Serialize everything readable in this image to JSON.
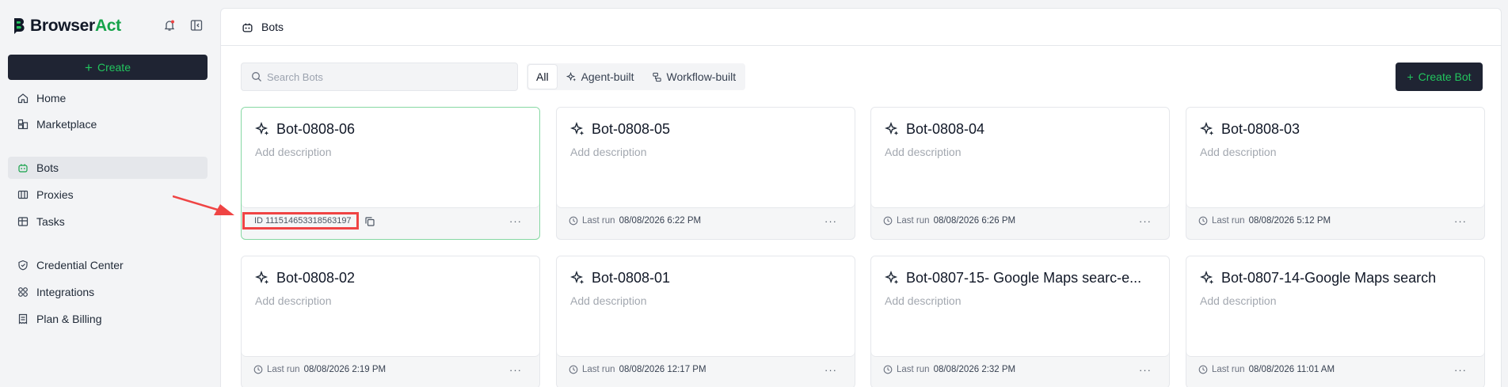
{
  "brand": {
    "name_part1": "Browser",
    "name_part2": "Act",
    "accent_color": "#16a34a"
  },
  "sidebar": {
    "create_label": "Create",
    "items": [
      {
        "label": "Home",
        "icon": "home-icon"
      },
      {
        "label": "Marketplace",
        "icon": "marketplace-icon"
      },
      {
        "label": "Bots",
        "icon": "bot-icon",
        "active": true
      },
      {
        "label": "Proxies",
        "icon": "proxy-icon"
      },
      {
        "label": "Tasks",
        "icon": "tasks-icon"
      },
      {
        "label": "Credential Center",
        "icon": "shield-icon"
      },
      {
        "label": "Integrations",
        "icon": "integrations-icon"
      },
      {
        "label": "Plan & Billing",
        "icon": "billing-icon"
      }
    ]
  },
  "header": {
    "title": "Bots"
  },
  "toolbar": {
    "search_placeholder": "Search Bots",
    "filters": [
      "All",
      "Agent-built",
      "Workflow-built"
    ],
    "active_filter": "All",
    "create_bot_label": "Create Bot"
  },
  "cards": [
    {
      "title": "Bot-0808-06",
      "description": "Add description",
      "footer_prefix": "ID",
      "footer_value": "111514653318563197",
      "selected": true
    },
    {
      "title": "Bot-0808-05",
      "description": "Add description",
      "footer_prefix": "Last run",
      "footer_value": "08/08/2026 6:22 PM"
    },
    {
      "title": "Bot-0808-04",
      "description": "Add description",
      "footer_prefix": "Last run",
      "footer_value": "08/08/2026 6:26 PM"
    },
    {
      "title": "Bot-0808-03",
      "description": "Add description",
      "footer_prefix": "Last run",
      "footer_value": "08/08/2026 5:12 PM"
    },
    {
      "title": "Bot-0808-02",
      "description": "Add description",
      "footer_prefix": "Last run",
      "footer_value": "08/08/2026 2:19 PM"
    },
    {
      "title": "Bot-0808-01",
      "description": "Add description",
      "footer_prefix": "Last run",
      "footer_value": "08/08/2026 12:17 PM"
    },
    {
      "title": "Bot-0807-15- Google Maps searc-e...",
      "description": "Add description",
      "footer_prefix": "Last run",
      "footer_value": "08/08/2026 2:32 PM"
    },
    {
      "title": "Bot-0807-14-Google Maps search",
      "description": "Add description",
      "footer_prefix": "Last run",
      "footer_value": "08/08/2026 11:01 AM"
    }
  ],
  "more_label": "···",
  "annotation_color": "#ef4444"
}
